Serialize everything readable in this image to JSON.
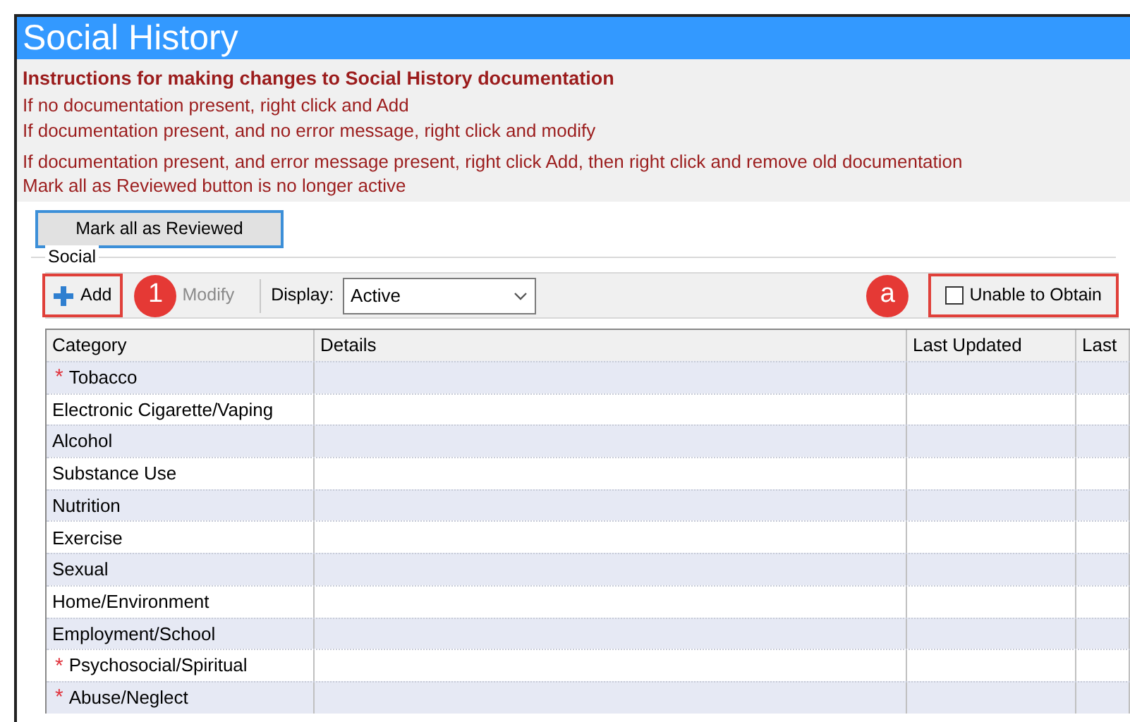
{
  "window": {
    "title": "Social History"
  },
  "instructions": {
    "heading": "Instructions for making changes to Social History documentation",
    "lines": [
      "If no documentation present, right click and Add",
      "If documentation present, and no error message, right click and modify",
      "If documentation present, and error message present, right click Add, then right click and remove old documentation",
      "Mark all as Reviewed button is no longer active"
    ]
  },
  "review_button": {
    "label": "Mark all as Reviewed"
  },
  "group": {
    "label": "Social"
  },
  "toolbar": {
    "add": {
      "label": "Add",
      "disabled": false,
      "callout": "1"
    },
    "modify": {
      "label": "Modify",
      "disabled": true
    },
    "display_label": "Display:",
    "display_value": "Active",
    "unable_to_obtain": {
      "label": "Unable to Obtain",
      "checked": false,
      "callout": "a"
    }
  },
  "table": {
    "columns": [
      "Category",
      "Details",
      "Last Updated",
      "Last"
    ],
    "rows": [
      {
        "category": "Tobacco",
        "required": true,
        "marker": "*"
      },
      {
        "category": "Electronic Cigarette/Vaping",
        "required": false
      },
      {
        "category": "Alcohol",
        "required": false
      },
      {
        "category": "Substance Use",
        "required": false
      },
      {
        "category": "Nutrition",
        "required": false
      },
      {
        "category": "Exercise",
        "required": false
      },
      {
        "category": "Sexual",
        "required": false
      },
      {
        "category": "Home/Environment",
        "required": false
      },
      {
        "category": "Employment/School",
        "required": false
      },
      {
        "category": "Psychosocial/Spiritual",
        "required": true,
        "marker": "*"
      },
      {
        "category": "Abuse/Neglect",
        "required": true,
        "marker": "*"
      }
    ]
  }
}
